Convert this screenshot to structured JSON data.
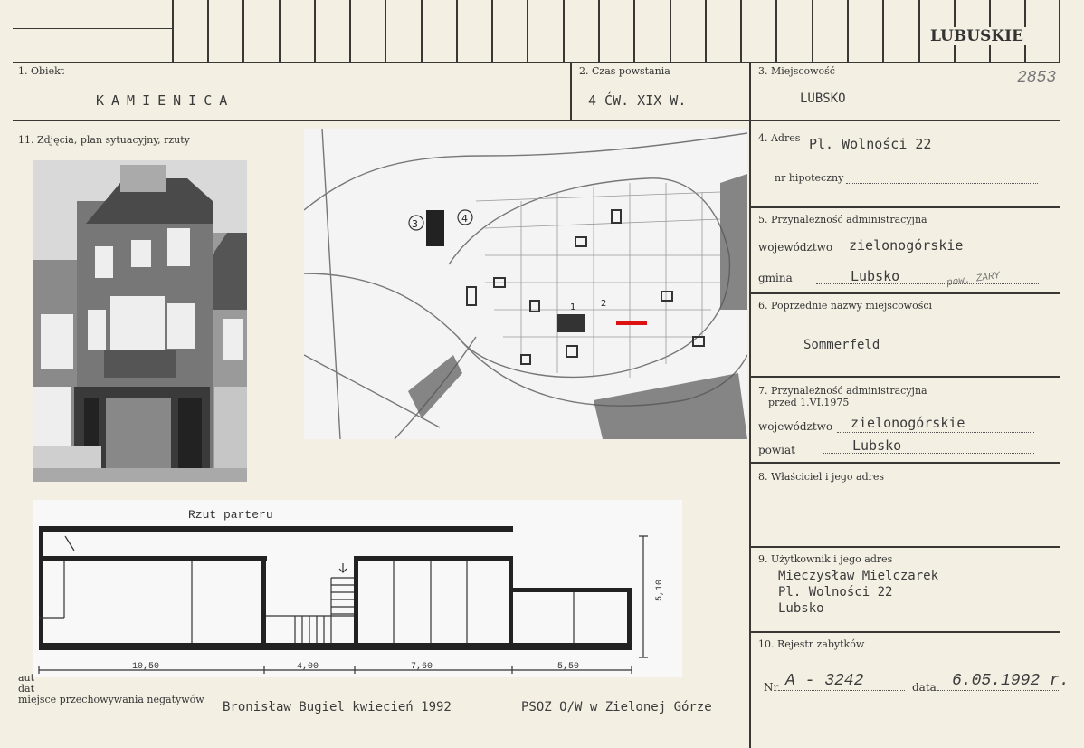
{
  "header": {
    "region": "LUBUSKIE",
    "card_number": "2853"
  },
  "fields": {
    "obiekt_label": "1. Obiekt",
    "obiekt_value": "KAMIENICA",
    "czas_label": "2. Czas powstania",
    "czas_value": "4 ĆW. XIX W.",
    "miejscowosc_label": "3. Miejscowość",
    "miejscowosc_value": "LUBSKO",
    "adres_label": "4. Adres",
    "adres_value": "Pl. Wolności 22",
    "hipoteczny_label": "nr hipoteczny",
    "przynaleznosc_label": "5. Przynależność administracyjna",
    "wojewodztwo_label": "województwo",
    "wojewodztwo_value": "zielonogórskie",
    "gmina_label": "gmina",
    "gmina_value": "Lubsko",
    "gmina_note": "pow. ŻARY",
    "poprzednie_label": "6. Poprzednie nazwy miejscowości",
    "poprzednie_value": "Sommerfeld",
    "przed_label": "7. Przynależność administracyjna",
    "przed_sub": "przed 1.VI.1975",
    "wojewodztwo2_label": "województwo",
    "wojewodztwo2_value": "zielonogórskie",
    "powiat_label": "powiat",
    "powiat_value": "Lubsko",
    "wlasciciel_label": "8. Właściciel i jego adres",
    "uzytkownik_label": "9. Użytkownik i jego adres",
    "uzytkownik_lines": [
      "Mieczysław Mielczarek",
      "Pl. Wolności 22",
      "Lubsko"
    ],
    "rejestr_label": "10. Rejestr zabytków",
    "nr_label": "Nr",
    "nr_value": "A - 3242",
    "data_label": "data",
    "data_value": "6.05.1992 r.",
    "zdjecia_label": "11. Zdjęcia, plan sytuacyjny, rzuty"
  },
  "plan": {
    "title": "Rzut parteru",
    "dims": [
      "10,50",
      "4,00",
      "7,60",
      "5,50"
    ],
    "height_dim": "5,10"
  },
  "footer": {
    "aut": "aut",
    "dat": "dat",
    "negatives_label": "miejsce przechowywania negatywów",
    "author_line": "Bronisław Bugiel kwiecień 1992",
    "institution": "PSOZ O/W w Zielonej Górze"
  },
  "map_markers": [
    "3",
    "4",
    "1",
    "2"
  ]
}
